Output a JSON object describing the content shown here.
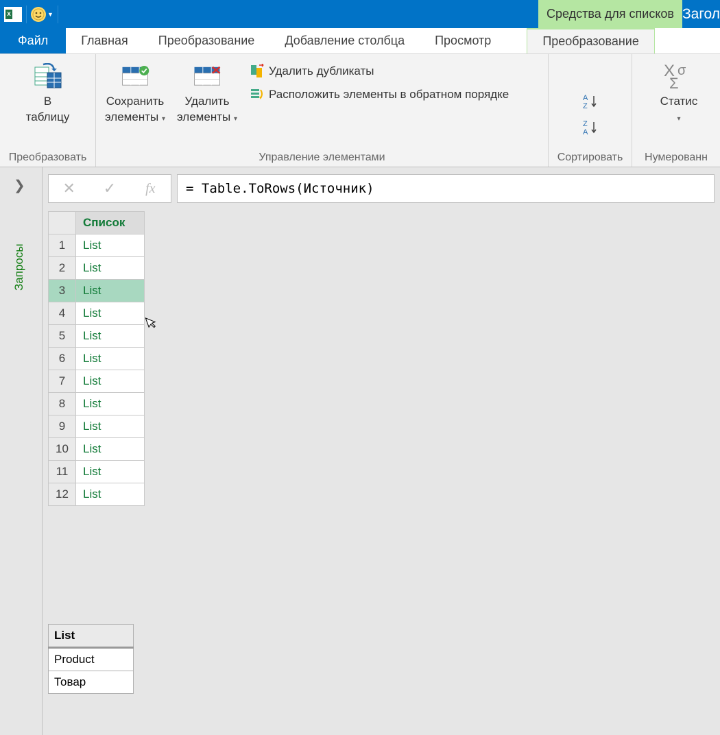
{
  "titlebar": {
    "contextual_tab": "Средства для списков",
    "title_suffix": "Загол"
  },
  "tabs": {
    "file": "Файл",
    "home": "Главная",
    "transform": "Преобразование",
    "addcolumn": "Добавление столбца",
    "view": "Просмотр",
    "list_transform": "Преобразование"
  },
  "ribbon": {
    "to_table": {
      "line1": "В",
      "line2": "таблицу"
    },
    "group_convert": "Преобразовать",
    "keep": {
      "line1": "Сохранить",
      "line2": "элементы"
    },
    "remove": {
      "line1": "Удалить",
      "line2": "элементы"
    },
    "remove_dup": "Удалить дубликаты",
    "reverse": "Расположить элементы в обратном порядке",
    "group_manage": "Управление элементами",
    "group_sort": "Сортировать",
    "stats": {
      "line1": "Статис"
    },
    "group_numeric": "Нумерованн"
  },
  "queries_pane": {
    "label": "Запросы"
  },
  "formula": "= Table.ToRows(Источник)",
  "grid": {
    "header": "Список",
    "rows": [
      {
        "n": "1",
        "v": "List"
      },
      {
        "n": "2",
        "v": "List"
      },
      {
        "n": "3",
        "v": "List"
      },
      {
        "n": "4",
        "v": "List"
      },
      {
        "n": "5",
        "v": "List"
      },
      {
        "n": "6",
        "v": "List"
      },
      {
        "n": "7",
        "v": "List"
      },
      {
        "n": "8",
        "v": "List"
      },
      {
        "n": "9",
        "v": "List"
      },
      {
        "n": "10",
        "v": "List"
      },
      {
        "n": "11",
        "v": "List"
      },
      {
        "n": "12",
        "v": "List"
      }
    ],
    "selected_index": 2
  },
  "preview": {
    "header": "List",
    "rows": [
      "Product",
      "Товар"
    ]
  }
}
